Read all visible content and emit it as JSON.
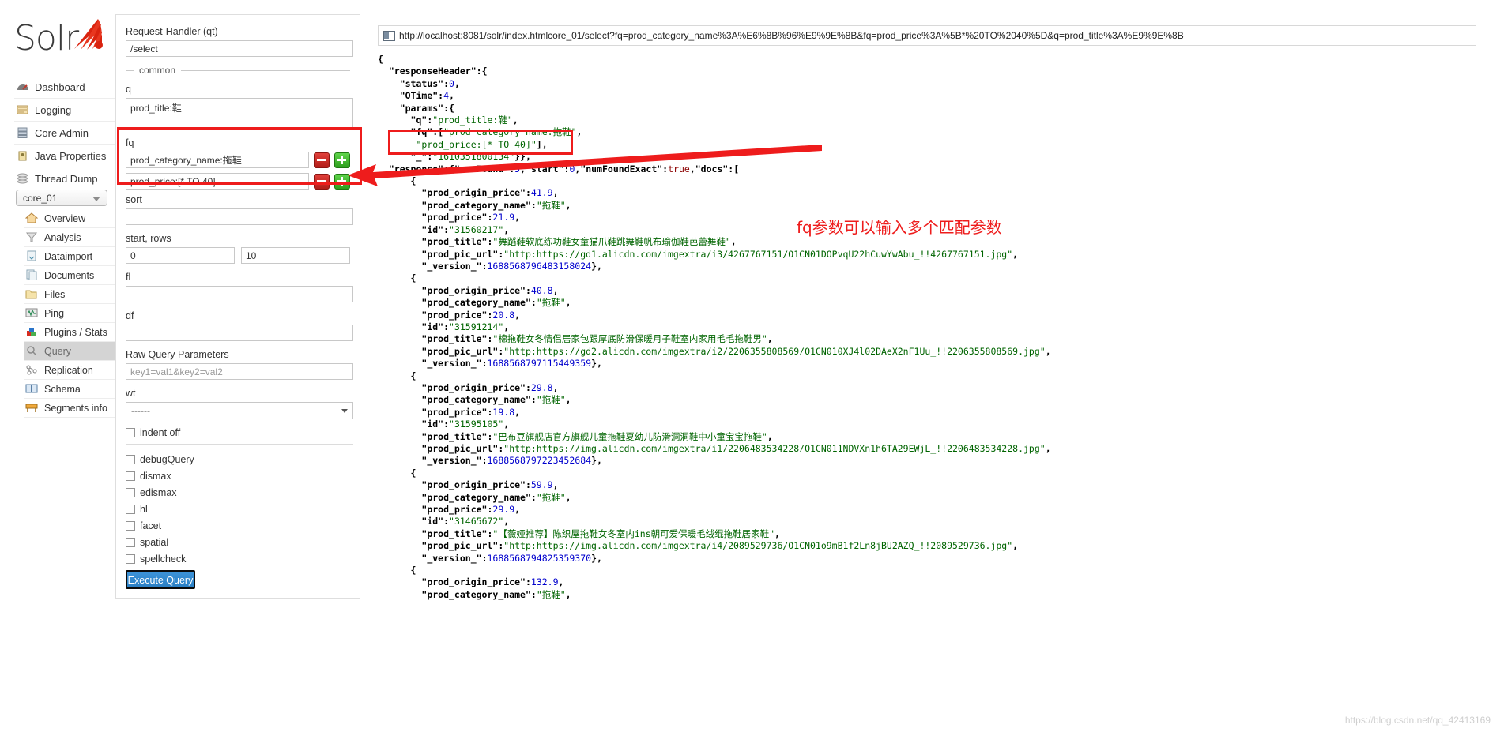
{
  "app": {
    "logo_text": "Solr",
    "watermark": "https://blog.csdn.net/qq_42413169"
  },
  "sidebar": {
    "global_items": [
      {
        "label": "Dashboard",
        "icon": "dashboard-icon"
      },
      {
        "label": "Logging",
        "icon": "logging-icon"
      },
      {
        "label": "Core Admin",
        "icon": "core-admin-icon"
      },
      {
        "label": "Java Properties",
        "icon": "java-properties-icon"
      },
      {
        "label": "Thread Dump",
        "icon": "thread-dump-icon"
      }
    ],
    "core_selector": {
      "value": "core_01"
    },
    "core_items": [
      {
        "label": "Overview",
        "icon": "home-icon",
        "active": false
      },
      {
        "label": "Analysis",
        "icon": "funnel-icon",
        "active": false
      },
      {
        "label": "Dataimport",
        "icon": "dataimport-icon",
        "active": false
      },
      {
        "label": "Documents",
        "icon": "documents-icon",
        "active": false
      },
      {
        "label": "Files",
        "icon": "folder-icon",
        "active": false
      },
      {
        "label": "Ping",
        "icon": "ping-icon",
        "active": false
      },
      {
        "label": "Plugins / Stats",
        "icon": "plugins-icon",
        "active": false
      },
      {
        "label": "Query",
        "icon": "magnifier-icon",
        "active": true
      },
      {
        "label": "Replication",
        "icon": "replication-icon",
        "active": false
      },
      {
        "label": "Schema",
        "icon": "book-icon",
        "active": false
      },
      {
        "label": "Segments info",
        "icon": "segments-icon",
        "active": false
      }
    ]
  },
  "form": {
    "request_handler_label": "Request-Handler (qt)",
    "request_handler_value": "/select",
    "common_legend": "common",
    "q_label": "q",
    "q_value": "prod_title:鞋",
    "fq_label": "fq",
    "fq_values": [
      "prod_category_name:拖鞋",
      "prod_price:[* TO 40]"
    ],
    "sort_label": "sort",
    "sort_value": "",
    "start_rows_label": "start, rows",
    "start_value": "0",
    "rows_value": "10",
    "fl_label": "fl",
    "fl_value": "",
    "df_label": "df",
    "df_value": "",
    "raw_query_label": "Raw Query Parameters",
    "raw_query_placeholder": "key1=val1&key2=val2",
    "wt_label": "wt",
    "wt_value": "------",
    "indent_off_label": "indent off",
    "checkboxes": [
      {
        "label": "debugQuery",
        "checked": false
      },
      {
        "label": "dismax",
        "checked": false
      },
      {
        "label": "edismax",
        "checked": false
      },
      {
        "label": "hl",
        "checked": false
      },
      {
        "label": "facet",
        "checked": false
      },
      {
        "label": "spatial",
        "checked": false
      },
      {
        "label": "spellcheck",
        "checked": false
      }
    ],
    "execute_label": "Execute Query",
    "minus_button_label": "remove fq",
    "plus_button_label": "add fq"
  },
  "result": {
    "url": "http://localhost:8081/solr/index.htmlcore_01/select?fq=prod_category_name%3A%E6%8B%96%E9%9E%8B&fq=prod_price%3A%5B*%20TO%2040%5D&q=prod_title%3A%E9%9E%8B",
    "response_header": {
      "status": 0,
      "QTime": 4,
      "params": {
        "q": "prod_title:鞋",
        "fq": [
          "prod_category_name:拖鞋",
          "prod_price:[* TO 40]"
        ],
        "_": "1610351800134"
      }
    },
    "response": {
      "numFound": 5,
      "start": 0,
      "numFoundExact": "true",
      "docs": [
        {
          "prod_origin_price": "41.9",
          "prod_category_name": "拖鞋",
          "prod_price": "21.9",
          "id": "31560217",
          "prod_title": "舞蹈鞋软底练功鞋女童猫爪鞋跳舞鞋帆布瑜伽鞋芭蕾舞鞋",
          "prod_pic_url": "http:https://gd1.alicdn.com/imgextra/i3/4267767151/O1CN01DOPvqU22hCuwYwAbu_!!4267767151.jpg",
          "_version_": "1688568796483158024"
        },
        {
          "prod_origin_price": "40.8",
          "prod_category_name": "拖鞋",
          "prod_price": "20.8",
          "id": "31591214",
          "prod_title": "棉拖鞋女冬情侣居家包跟厚底防滑保暖月子鞋室内家用毛毛拖鞋男",
          "prod_pic_url": "http:https://gd2.alicdn.com/imgextra/i2/2206355808569/O1CN010XJ4l02DAeX2nF1Uu_!!2206355808569.jpg",
          "_version_": "1688568797115449359"
        },
        {
          "prod_origin_price": "29.8",
          "prod_category_name": "拖鞋",
          "prod_price": "19.8",
          "id": "31595105",
          "prod_title": "巴布豆旗舰店官方旗舰儿童拖鞋夏幼儿防滑洞洞鞋中小童宝宝拖鞋",
          "prod_pic_url": "http:https://img.alicdn.com/imgextra/i1/2206483534228/O1CN011NDVXn1h6TA29EWjL_!!2206483534228.jpg",
          "_version_": "1688568797223452684"
        },
        {
          "prod_origin_price": "59.9",
          "prod_category_name": "拖鞋",
          "prod_price": "29.9",
          "id": "31465672",
          "prod_title": "【薇娅推荐】陈织屋拖鞋女冬室内ins朝可爱保暖毛绒绲拖鞋居家鞋",
          "prod_pic_url": "http:https://img.alicdn.com/imgextra/i4/2089529736/O1CN01o9mB1f2Ln8jBU2AZQ_!!2089529736.jpg",
          "_version_": "1688568794825359370"
        },
        {
          "prod_origin_price": "132.9",
          "prod_category_name": "拖鞋"
        }
      ]
    }
  },
  "annotation": {
    "text": "fq参数可以输入多个匹配参数",
    "color": "#ee1c1c"
  }
}
